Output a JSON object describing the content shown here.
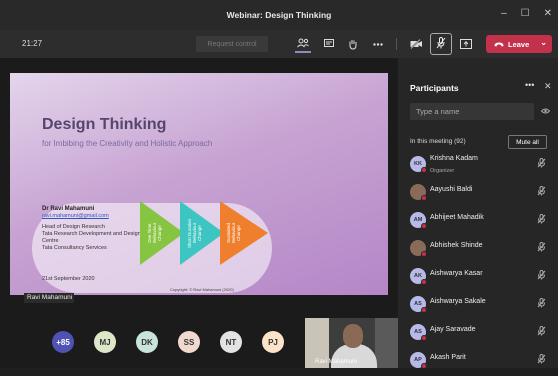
{
  "window": {
    "title": "Webinar: Design Thinking",
    "controls": [
      "–",
      "☐",
      "✕"
    ]
  },
  "toolbar": {
    "clock": "21:27",
    "request_control": "Request control",
    "leave_label": "Leave",
    "icons": [
      "people-icon",
      "chat-icon",
      "raise-hand-icon",
      "more-icon",
      "camera-off-icon",
      "mic-off-icon",
      "share-icon"
    ]
  },
  "slide": {
    "title": "Design Thinking",
    "subtitle": "for Imbibing the Creativity and Holistic Approach",
    "presenter_name": "Dr Ravi Mahamuni",
    "presenter_email": "ravi.mahamuni@gmail.com",
    "role_lines": [
      "Head of Design Research",
      "Tata Research Development and Design",
      "Centre",
      "Tata Consultancy Services"
    ],
    "date": "21st September 2020",
    "copyright": "Copyright: © Ravi Mahamuni (2020)",
    "triangles": [
      {
        "label": "One Time Behaviour Change",
        "color": "#86c541"
      },
      {
        "label": "Short Duration Behaviour Change",
        "color": "#3dc5c1"
      },
      {
        "label": "Sustained Behaviour Change",
        "color": "#ef7f2c"
      }
    ]
  },
  "presenter_badge": "Ravi Mahamuni",
  "attendee_avatars": [
    {
      "initials": "+85",
      "color": "#4f52b2",
      "text_color": "#ffffff"
    },
    {
      "initials": "MJ",
      "color": "#dde7c8",
      "text_color": "#333333"
    },
    {
      "initials": "DK",
      "color": "#c9e4da",
      "text_color": "#333333"
    },
    {
      "initials": "SS",
      "color": "#f1d9d0",
      "text_color": "#333333"
    },
    {
      "initials": "NT",
      "color": "#e3e3e3",
      "text_color": "#333333"
    },
    {
      "initials": "PJ",
      "color": "#fbe4c9",
      "text_color": "#333333"
    }
  ],
  "video_label": "Ravi Mahamuni",
  "participants": {
    "title": "Participants",
    "search_placeholder": "Type a name",
    "in_meeting": "In this meeting (92)",
    "mute_all": "Mute all",
    "list": [
      {
        "name": "Krishna Kadam",
        "role": "Organizer",
        "initials": "KK",
        "photo": false
      },
      {
        "name": "Aayushi Baldi",
        "role": "",
        "initials": "",
        "photo": true
      },
      {
        "name": "Abhijeet Mahadik",
        "role": "",
        "initials": "AM",
        "photo": false
      },
      {
        "name": "Abhishek Shinde",
        "role": "",
        "initials": "",
        "photo": true
      },
      {
        "name": "Aishwarya Kasar",
        "role": "",
        "initials": "AK",
        "photo": false
      },
      {
        "name": "Aishwarya Sakale",
        "role": "",
        "initials": "AS",
        "photo": false
      },
      {
        "name": "Ajay Saravade",
        "role": "",
        "initials": "AS",
        "photo": false
      },
      {
        "name": "Akash Parit",
        "role": "",
        "initials": "AP",
        "photo": false
      }
    ]
  }
}
